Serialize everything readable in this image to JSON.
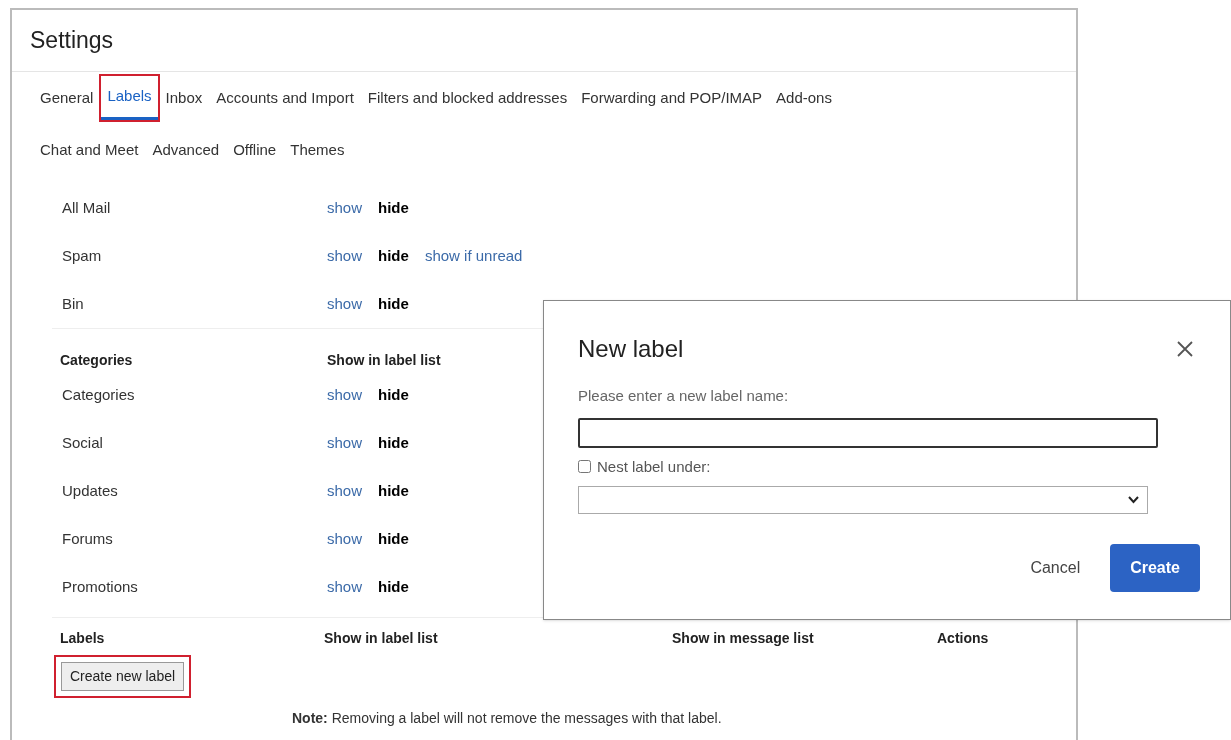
{
  "title": "Settings",
  "tab_rows": [
    [
      {
        "label": "General",
        "selected": false,
        "highlighted": false
      },
      {
        "label": "Labels",
        "selected": true,
        "highlighted": true
      },
      {
        "label": "Inbox",
        "selected": false,
        "highlighted": false
      },
      {
        "label": "Accounts and Import",
        "selected": false,
        "highlighted": false
      },
      {
        "label": "Filters and blocked addresses",
        "selected": false,
        "highlighted": false
      },
      {
        "label": "Forwarding and POP/IMAP",
        "selected": false,
        "highlighted": false
      },
      {
        "label": "Add-ons",
        "selected": false,
        "highlighted": false
      }
    ],
    [
      {
        "label": "Chat and Meet",
        "selected": false,
        "highlighted": false
      },
      {
        "label": "Advanced",
        "selected": false,
        "highlighted": false
      },
      {
        "label": "Offline",
        "selected": false,
        "highlighted": false
      },
      {
        "label": "Themes",
        "selected": false,
        "highlighted": false
      }
    ]
  ],
  "system_labels": [
    {
      "name": "All Mail",
      "options": [
        {
          "label": "show",
          "selected": false
        },
        {
          "label": "hide",
          "selected": true
        }
      ]
    },
    {
      "name": "Spam",
      "options": [
        {
          "label": "show",
          "selected": false
        },
        {
          "label": "hide",
          "selected": true
        },
        {
          "label": "show if unread",
          "selected": false
        }
      ]
    },
    {
      "name": "Bin",
      "options": [
        {
          "label": "show",
          "selected": false
        },
        {
          "label": "hide",
          "selected": true
        }
      ]
    }
  ],
  "categories": {
    "columns": [
      "Categories",
      "Show in label list"
    ],
    "rows": [
      {
        "name": "Categories",
        "options": [
          {
            "label": "show",
            "selected": false
          },
          {
            "label": "hide",
            "selected": true
          }
        ]
      },
      {
        "name": "Social",
        "options": [
          {
            "label": "show",
            "selected": false
          },
          {
            "label": "hide",
            "selected": true
          }
        ]
      },
      {
        "name": "Updates",
        "options": [
          {
            "label": "show",
            "selected": false
          },
          {
            "label": "hide",
            "selected": true
          }
        ]
      },
      {
        "name": "Forums",
        "options": [
          {
            "label": "show",
            "selected": false
          },
          {
            "label": "hide",
            "selected": true
          }
        ]
      },
      {
        "name": "Promotions",
        "options": [
          {
            "label": "show",
            "selected": false
          },
          {
            "label": "hide",
            "selected": true
          }
        ]
      }
    ]
  },
  "labels": {
    "columns": [
      "Labels",
      "Show in label list",
      "Show in message list",
      "Actions"
    ],
    "create_button": {
      "label": "Create new label",
      "highlighted": true
    },
    "note": "**Note:** Removing a label will not remove the messages with that label."
  },
  "dialog": {
    "title": "New label",
    "name_label": "Please enter a new label name:",
    "nest": {
      "label": "Nest label under:",
      "checked": false
    },
    "buttons": [
      {
        "label": "Cancel",
        "kind": "text"
      },
      {
        "label": "Create",
        "kind": "primary"
      }
    ]
  }
}
